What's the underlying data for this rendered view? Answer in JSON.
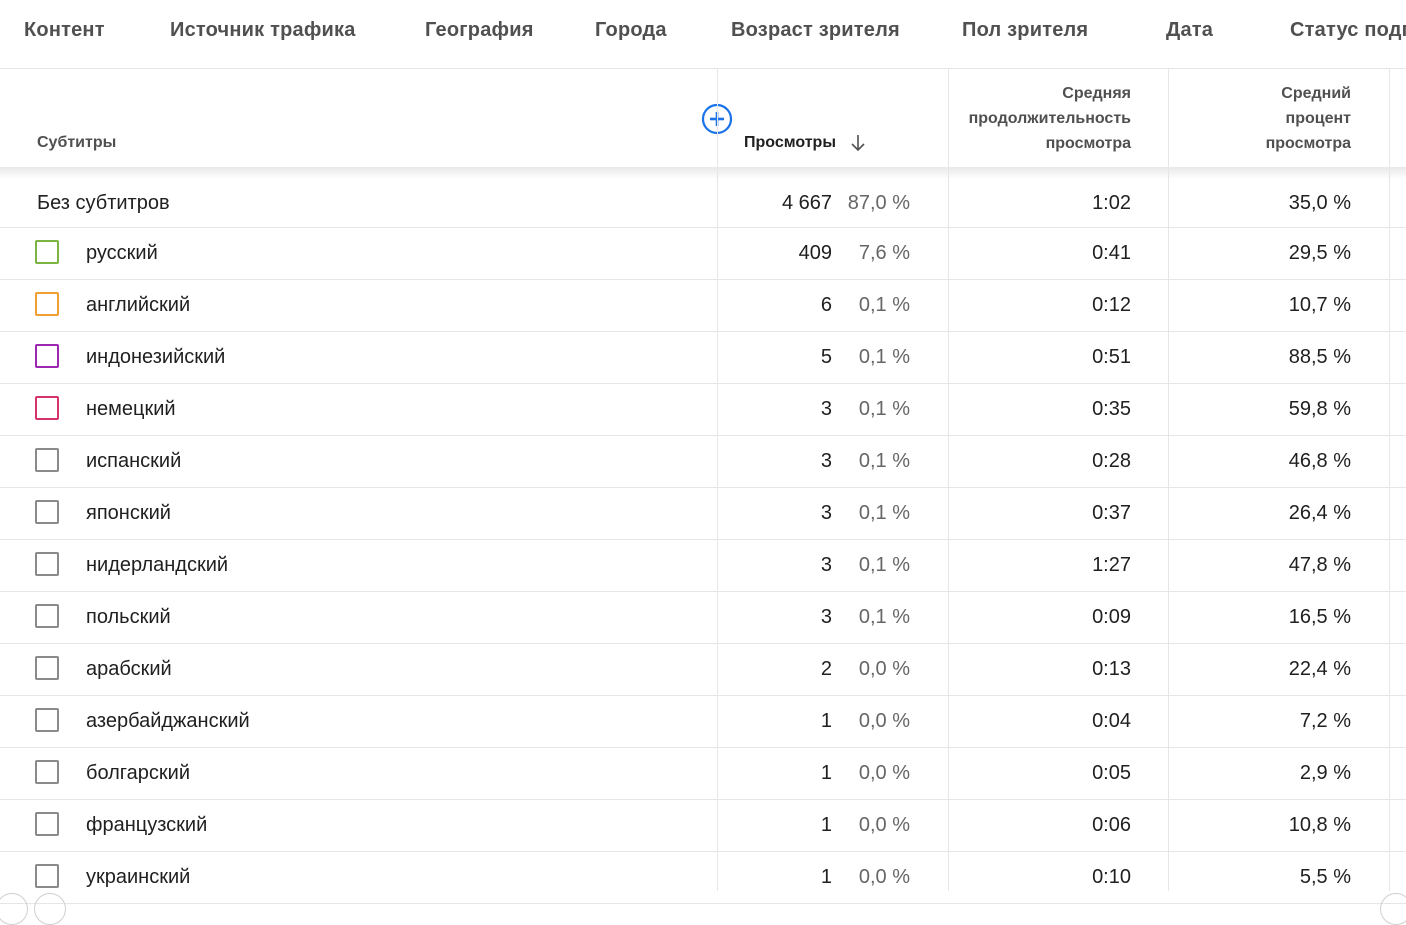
{
  "tabs": [
    "Контент",
    "Источник трафика",
    "География",
    "Города",
    "Возраст зрителя",
    "Пол зрителя",
    "Дата",
    "Статус подписки"
  ],
  "header": {
    "subtitles": "Субтитры",
    "views": "Просмотры",
    "avg_duration_line1": "Средняя",
    "avg_duration_line2": "продолжительность",
    "avg_duration_line3": "просмотра",
    "avg_percent_line1": "Средний",
    "avg_percent_line2": "процент",
    "avg_percent_line3": "просмотра"
  },
  "colors": {
    "accent": "#1a73e8",
    "russian": "#7cb342",
    "english": "#f0a030",
    "indonesian": "#9c27b0",
    "german": "#d6336c",
    "default_checkbox": "#8a8a8a"
  },
  "rows": [
    {
      "name": "Без субтитров",
      "views": "4 667",
      "share": "87,0 %",
      "duration": "1:02",
      "percent": "35,0 %"
    },
    {
      "name": "русский",
      "views": "409",
      "share": "7,6 %",
      "duration": "0:41",
      "percent": "29,5 %",
      "color": "#7cb342"
    },
    {
      "name": "английский",
      "views": "6",
      "share": "0,1 %",
      "duration": "0:12",
      "percent": "10,7 %",
      "color": "#f0a030"
    },
    {
      "name": "индонезийский",
      "views": "5",
      "share": "0,1 %",
      "duration": "0:51",
      "percent": "88,5 %",
      "color": "#9c27b0"
    },
    {
      "name": "немецкий",
      "views": "3",
      "share": "0,1 %",
      "duration": "0:35",
      "percent": "59,8 %",
      "color": "#d6336c"
    },
    {
      "name": "испанский",
      "views": "3",
      "share": "0,1 %",
      "duration": "0:28",
      "percent": "46,8 %"
    },
    {
      "name": "японский",
      "views": "3",
      "share": "0,1 %",
      "duration": "0:37",
      "percent": "26,4 %"
    },
    {
      "name": "нидерландский",
      "views": "3",
      "share": "0,1 %",
      "duration": "1:27",
      "percent": "47,8 %"
    },
    {
      "name": "польский",
      "views": "3",
      "share": "0,1 %",
      "duration": "0:09",
      "percent": "16,5 %"
    },
    {
      "name": "арабский",
      "views": "2",
      "share": "0,0 %",
      "duration": "0:13",
      "percent": "22,4 %"
    },
    {
      "name": "азербайджанский",
      "views": "1",
      "share": "0,0 %",
      "duration": "0:04",
      "percent": "7,2 %"
    },
    {
      "name": "болгарский",
      "views": "1",
      "share": "0,0 %",
      "duration": "0:05",
      "percent": "2,9 %"
    },
    {
      "name": "французский",
      "views": "1",
      "share": "0,0 %",
      "duration": "0:06",
      "percent": "10,8 %"
    },
    {
      "name": "украинский",
      "views": "1",
      "share": "0,0 %",
      "duration": "0:10",
      "percent": "5,5 %"
    }
  ]
}
